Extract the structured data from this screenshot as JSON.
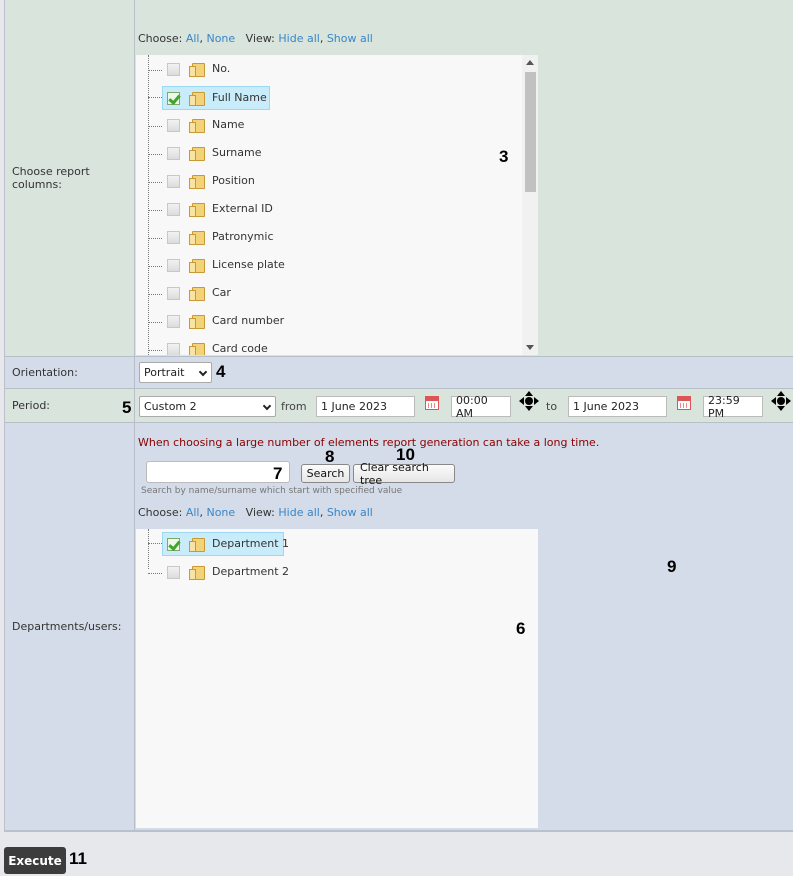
{
  "columns_row": {
    "label": "Choose report columns:",
    "choose_label": "Choose:",
    "all": "All",
    "none": "None",
    "view_label": "View:",
    "hide_all": "Hide all",
    "show_all": "Show all",
    "items": [
      {
        "label": "No.",
        "checked": false
      },
      {
        "label": "Full Name",
        "checked": true
      },
      {
        "label": "Name",
        "checked": false
      },
      {
        "label": "Surname",
        "checked": false
      },
      {
        "label": "Position",
        "checked": false
      },
      {
        "label": "External ID",
        "checked": false
      },
      {
        "label": "Patronymic",
        "checked": false
      },
      {
        "label": "License plate",
        "checked": false
      },
      {
        "label": "Car",
        "checked": false
      },
      {
        "label": "Card number",
        "checked": false
      },
      {
        "label": "Card code",
        "checked": false
      }
    ]
  },
  "orientation_row": {
    "label": "Orientation:",
    "value": "Portrait"
  },
  "period_row": {
    "label": "Period:",
    "preset": "Custom 2",
    "from_label": "from",
    "from_date": "1 June 2023",
    "from_time": "00:00 AM",
    "to_label": "to",
    "to_date": "1 June 2023",
    "to_time": "23:59 PM"
  },
  "departments_row": {
    "label": "Departments/users:",
    "warning": "When choosing a large number of elements report generation can take a long time.",
    "search_value": "",
    "search_button": "Search",
    "clear_button": "Clear search tree",
    "search_hint": "Search by name/surname which start with specified value",
    "choose_label": "Choose:",
    "all": "All",
    "none": "None",
    "view_label": "View:",
    "hide_all": "Hide all",
    "show_all": "Show all",
    "items": [
      {
        "label": "Department 1",
        "checked": true
      },
      {
        "label": "Department 2",
        "checked": false
      }
    ]
  },
  "execute_button": "Execute",
  "callouts": [
    "3",
    "4",
    "5",
    "6",
    "7",
    "8",
    "9",
    "10",
    "11"
  ],
  "colors": {
    "warning_text": "#8b0000",
    "link": "#3a86c8",
    "selection": "#c9ecfb"
  }
}
